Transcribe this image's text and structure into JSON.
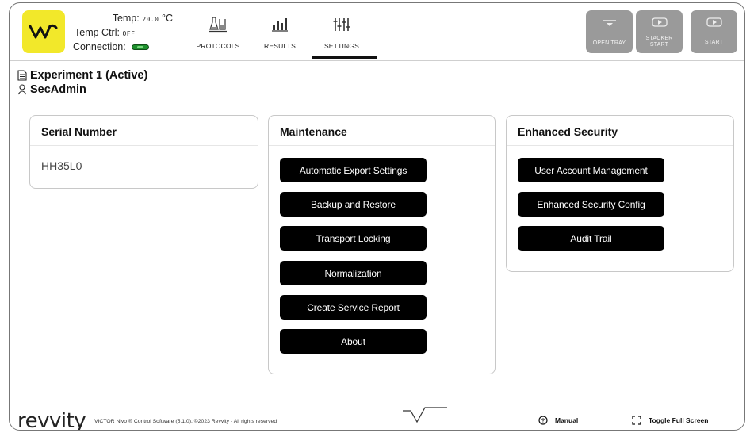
{
  "header": {
    "logo_text": "W",
    "temp_label": "Temp:",
    "temp_value": "20.0",
    "temp_unit": "°C",
    "temp_ctrl_label": "Temp Ctrl:",
    "temp_ctrl_value": "OFF",
    "connection_label": "Connection:",
    "connection_color": "#1c8f2c",
    "nav": [
      {
        "label": "PROTOCOLS",
        "icon": "flask-icon"
      },
      {
        "label": "RESULTS",
        "icon": "plate-icon"
      },
      {
        "label": "SETTINGS",
        "icon": "sliders-icon",
        "active": true
      }
    ],
    "actions": [
      {
        "label_lines": [
          "OPEN TRAY"
        ],
        "icon": "tray-icon"
      },
      {
        "label_lines": [
          "STACKER",
          "START"
        ],
        "icon": "stacker-icon"
      },
      {
        "label_lines": [
          "START"
        ],
        "icon": "start-icon"
      }
    ]
  },
  "experiment": {
    "name": "Experiment 1 (Active)",
    "user": "SecAdmin"
  },
  "cards": {
    "serial": {
      "title": "Serial Number",
      "value": "HH35L0"
    },
    "maintenance": {
      "title": "Maintenance",
      "buttons": [
        "Automatic Export Settings",
        "Backup and Restore",
        "Transport Locking",
        "Normalization",
        "Create Service Report",
        "About"
      ]
    },
    "security": {
      "title": "Enhanced Security",
      "buttons": [
        "User Account Management",
        "Enhanced Security Config",
        "Audit Trail"
      ]
    }
  },
  "footer": {
    "brand": "revvity",
    "copyright": "VICTOR Nivo ® Control Software (5.1.0), ©2023 Revvity - All rights reserved",
    "manual_label": "Manual",
    "fullscreen_label": "Toggle Full Screen"
  },
  "colors": {
    "logo_bg": "#f2e82a",
    "action_button_bg": "#9a9a9a",
    "primary_button_bg": "#000000"
  }
}
